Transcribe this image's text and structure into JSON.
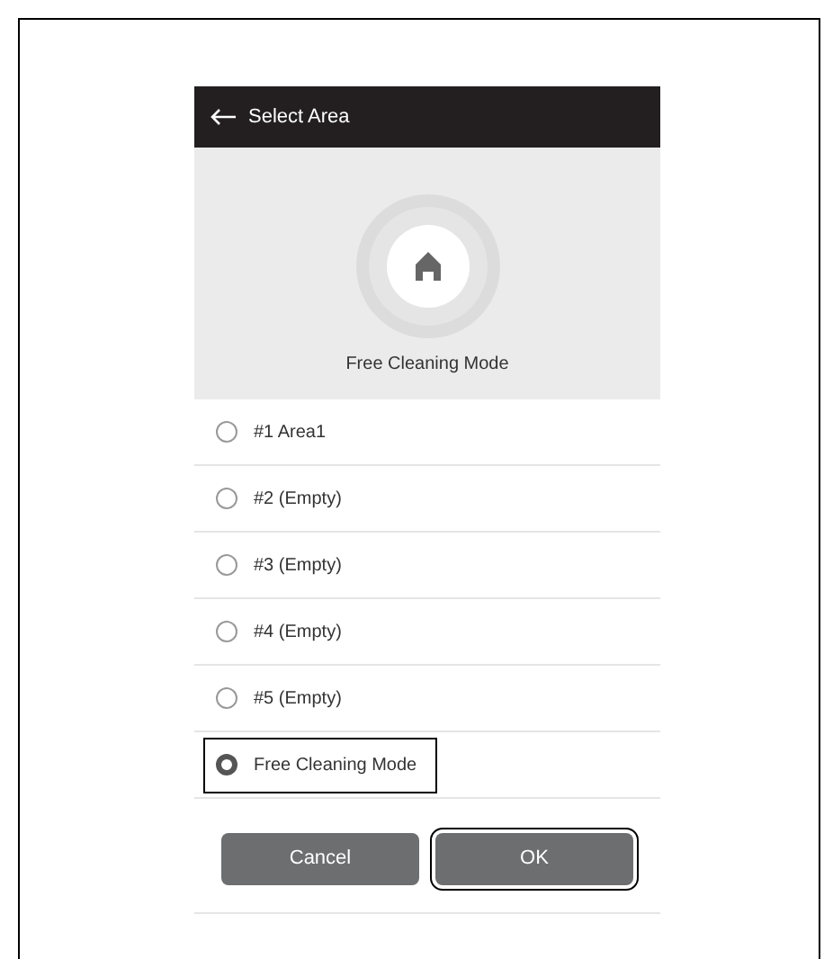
{
  "header": {
    "title": "Select Area"
  },
  "mode_display": {
    "label": "Free Cleaning Mode"
  },
  "options": [
    {
      "label": "#1 Area1",
      "selected": false,
      "highlighted": false
    },
    {
      "label": "#2 (Empty)",
      "selected": false,
      "highlighted": false
    },
    {
      "label": "#3 (Empty)",
      "selected": false,
      "highlighted": false
    },
    {
      "label": "#4 (Empty)",
      "selected": false,
      "highlighted": false
    },
    {
      "label": "#5 (Empty)",
      "selected": false,
      "highlighted": false
    },
    {
      "label": "Free Cleaning Mode",
      "selected": true,
      "highlighted": true
    }
  ],
  "buttons": [
    {
      "label": "Cancel",
      "highlighted": false
    },
    {
      "label": "OK",
      "highlighted": true
    }
  ]
}
